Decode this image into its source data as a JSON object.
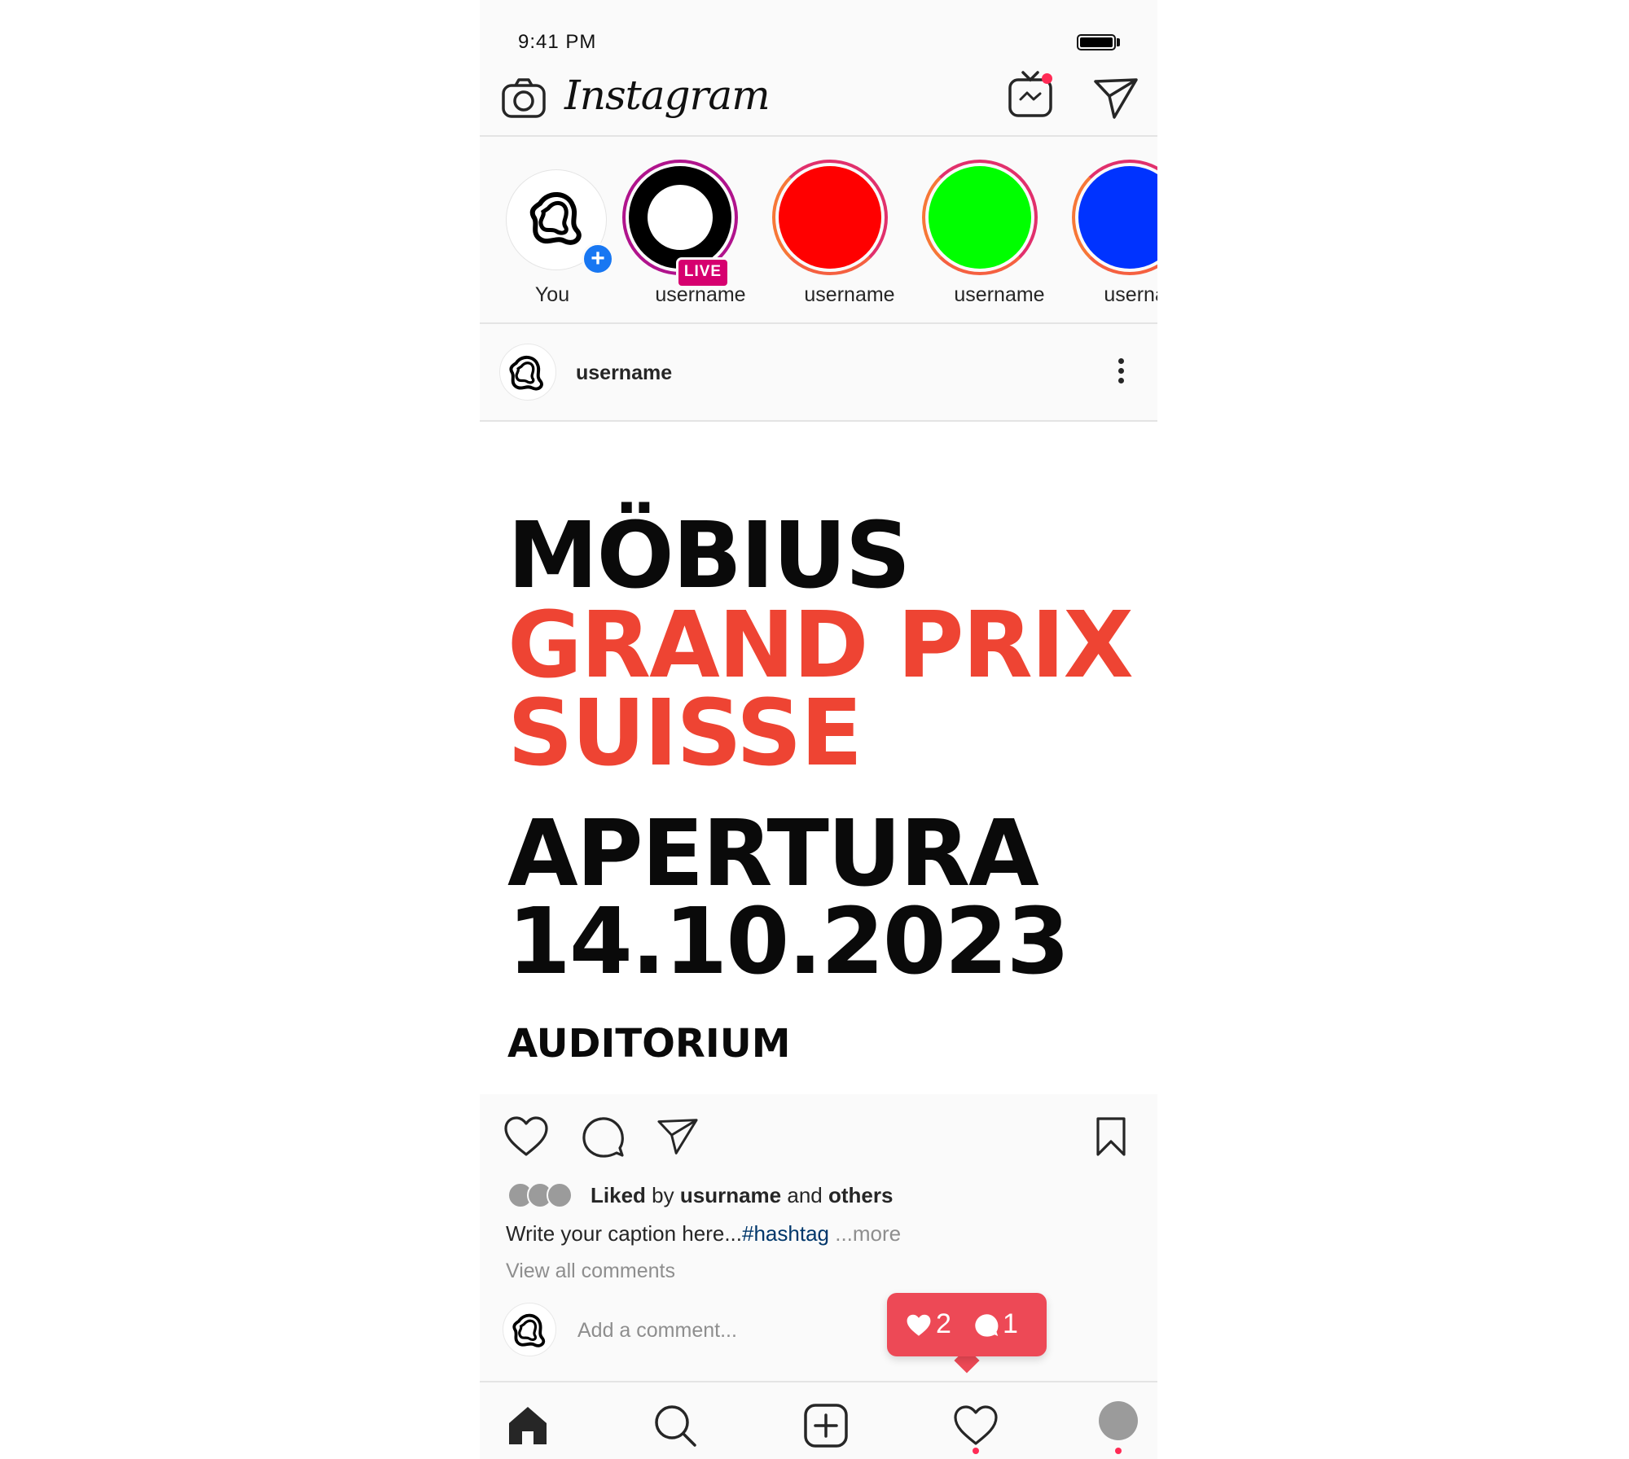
{
  "status_bar": {
    "time": "9:41 PM"
  },
  "header": {
    "logo": "Instagram",
    "icons": [
      "camera-icon",
      "igtv-icon",
      "direct-message-icon"
    ]
  },
  "stories": [
    {
      "label": "You",
      "color": "#ffffff"
    },
    {
      "label": "username",
      "color": "#000000",
      "badge": "LIVE"
    },
    {
      "label": "username",
      "color": "#ff0000"
    },
    {
      "label": "username",
      "color": "#00ff00"
    },
    {
      "label": "username",
      "color": "#0033ff"
    }
  ],
  "post": {
    "username": "username",
    "poster": {
      "title": "MÖBIUS",
      "subtitle_line1": "GRAND PRIX",
      "subtitle_line2": "SUISSE",
      "event": "APERTURA",
      "date": "14.10.2023",
      "venue": "AUDITORIUM"
    },
    "likes": {
      "liked": "Liked",
      "by": "by",
      "user": "usurname",
      "and": "and",
      "others": "others"
    },
    "caption": {
      "text": "Write your caption here...",
      "hashtag": "#hashtag",
      "more": "...more"
    },
    "view_comments": "View all comments",
    "comment_placeholder": "Add a comment..."
  },
  "notification": {
    "likes": "2",
    "comments": "1",
    "color": "#ed4956"
  },
  "tab_bar": [
    "home-icon",
    "search-icon",
    "new-post-icon",
    "activity-icon",
    "profile-icon"
  ]
}
